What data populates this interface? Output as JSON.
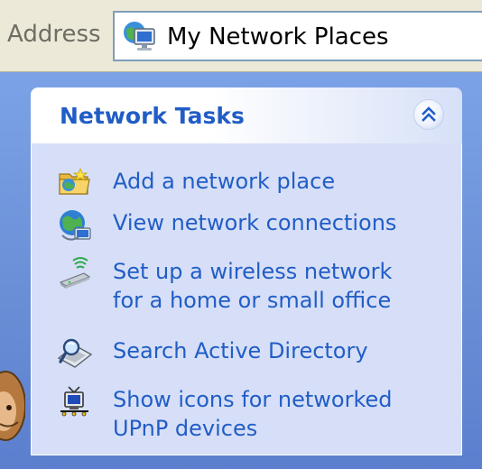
{
  "address_bar": {
    "label": "Address",
    "value": "My Network Places",
    "icon": "my-network-places-icon"
  },
  "panel": {
    "title": "Network Tasks",
    "collapse_icon": "double-chevron-up-icon",
    "tasks": [
      {
        "line1": "Add a network place",
        "line2": "",
        "icon": "add-network-place-icon"
      },
      {
        "line1": "View network connections",
        "line2": "",
        "icon": "network-connections-icon"
      },
      {
        "line1": "Set up a wireless network",
        "line2": "for a home or small office",
        "icon": "wireless-network-icon"
      },
      {
        "line1": "Search Active Directory",
        "line2": "",
        "icon": "search-directory-icon"
      },
      {
        "line1": "Show icons for networked",
        "line2": "UPnP devices",
        "icon": "upnp-devices-icon"
      }
    ]
  },
  "colors": {
    "pane_blue": "#6b8fd6",
    "link_blue": "#215dc6",
    "panel_body": "#d6dff7",
    "address_bg": "#ece9d8"
  }
}
